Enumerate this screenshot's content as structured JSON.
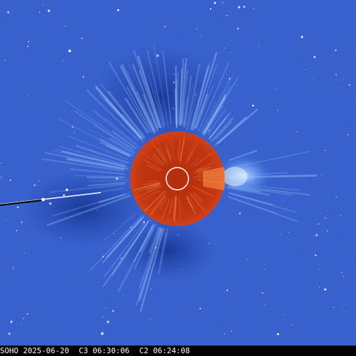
{
  "image": {
    "kind": "coronagraph composite",
    "background_color": "#2a55c8",
    "occulter_color": "#c0320f",
    "sun_outline_color": "#ffffff"
  },
  "caption": {
    "observatory": "SOHO",
    "date": "2025-06-20",
    "c3_label": "C3",
    "c3_time": "06:30:06",
    "c2_label": "C2",
    "c2_time": "06:24:08"
  }
}
